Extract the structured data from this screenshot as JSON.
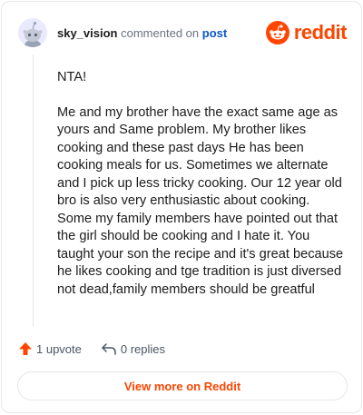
{
  "header": {
    "username": "sky_vision",
    "action_text": "commented on",
    "post_link": "post",
    "brand": "reddit"
  },
  "comment": {
    "paragraphs": [
      "NTA!",
      "Me and my brother have the exact same age as yours and Same problem. My brother likes cooking and these past days He has been cooking meals for us. Sometimes we alternate and I pick up less tricky cooking. Our 12 year old bro is also very enthusiastic about cooking. Some my family members have pointed out that the girl should be cooking and I hate it. You taught your son the recipe and it's great because he likes cooking and tge tradition is just diversed not dead,family members should be greatful"
    ]
  },
  "actions": {
    "upvote_label": "1 upvote",
    "replies_label": "0 replies"
  },
  "cta": {
    "label": "View more on Reddit"
  },
  "colors": {
    "brand": "#ff4500",
    "link": "#0b57d0",
    "avatar_bg": "#eaeaff"
  }
}
